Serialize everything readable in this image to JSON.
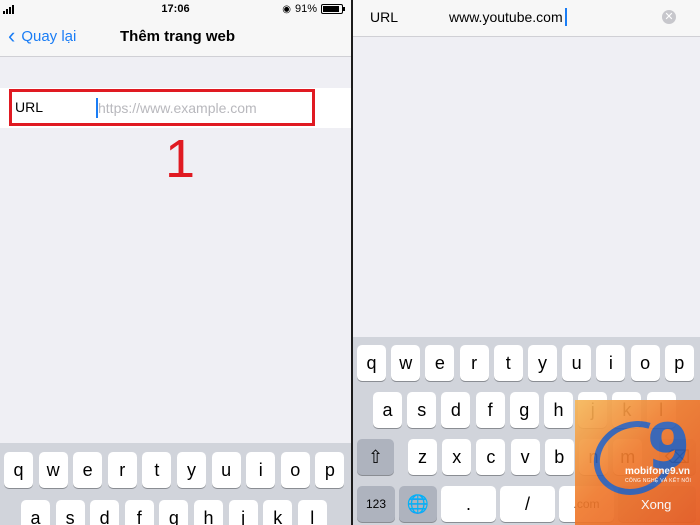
{
  "left": {
    "status": {
      "time": "17:06",
      "battery": "91%"
    },
    "nav": {
      "back_label": "Quay lại",
      "title": "Thêm trang web"
    },
    "url_row": {
      "label": "URL",
      "placeholder": "https://www.example.com"
    },
    "step_number": "1",
    "keyboard_row1": [
      "q",
      "w",
      "e",
      "r",
      "t",
      "y",
      "u",
      "i",
      "o",
      "p"
    ],
    "keyboard_row2": [
      "a",
      "s",
      "d",
      "f",
      "g",
      "h",
      "j",
      "k",
      "l"
    ]
  },
  "right": {
    "url_bar": {
      "label": "URL",
      "value": "www.youtube.com"
    },
    "keyboard": {
      "row1": [
        "q",
        "w",
        "e",
        "r",
        "t",
        "y",
        "u",
        "i",
        "o",
        "p"
      ],
      "row2": [
        "a",
        "s",
        "d",
        "f",
        "g",
        "h",
        "j",
        "k",
        "l"
      ],
      "row3": [
        "z",
        "x",
        "c",
        "v",
        "b",
        "n",
        "m"
      ],
      "numbers_key": "123",
      "dot_key": ".",
      "slash_key": "/",
      "com_key": ".com",
      "done_key": "Xong"
    }
  },
  "watermark": {
    "brand": "mobifone9",
    "domain": ".vn",
    "tagline": "CÔNG NGHỆ VÀ KẾT NỐI"
  },
  "colors": {
    "ios_blue": "#1a7df5",
    "highlight_red": "#e01a22",
    "keyboard_bg": "#d1d4db"
  }
}
